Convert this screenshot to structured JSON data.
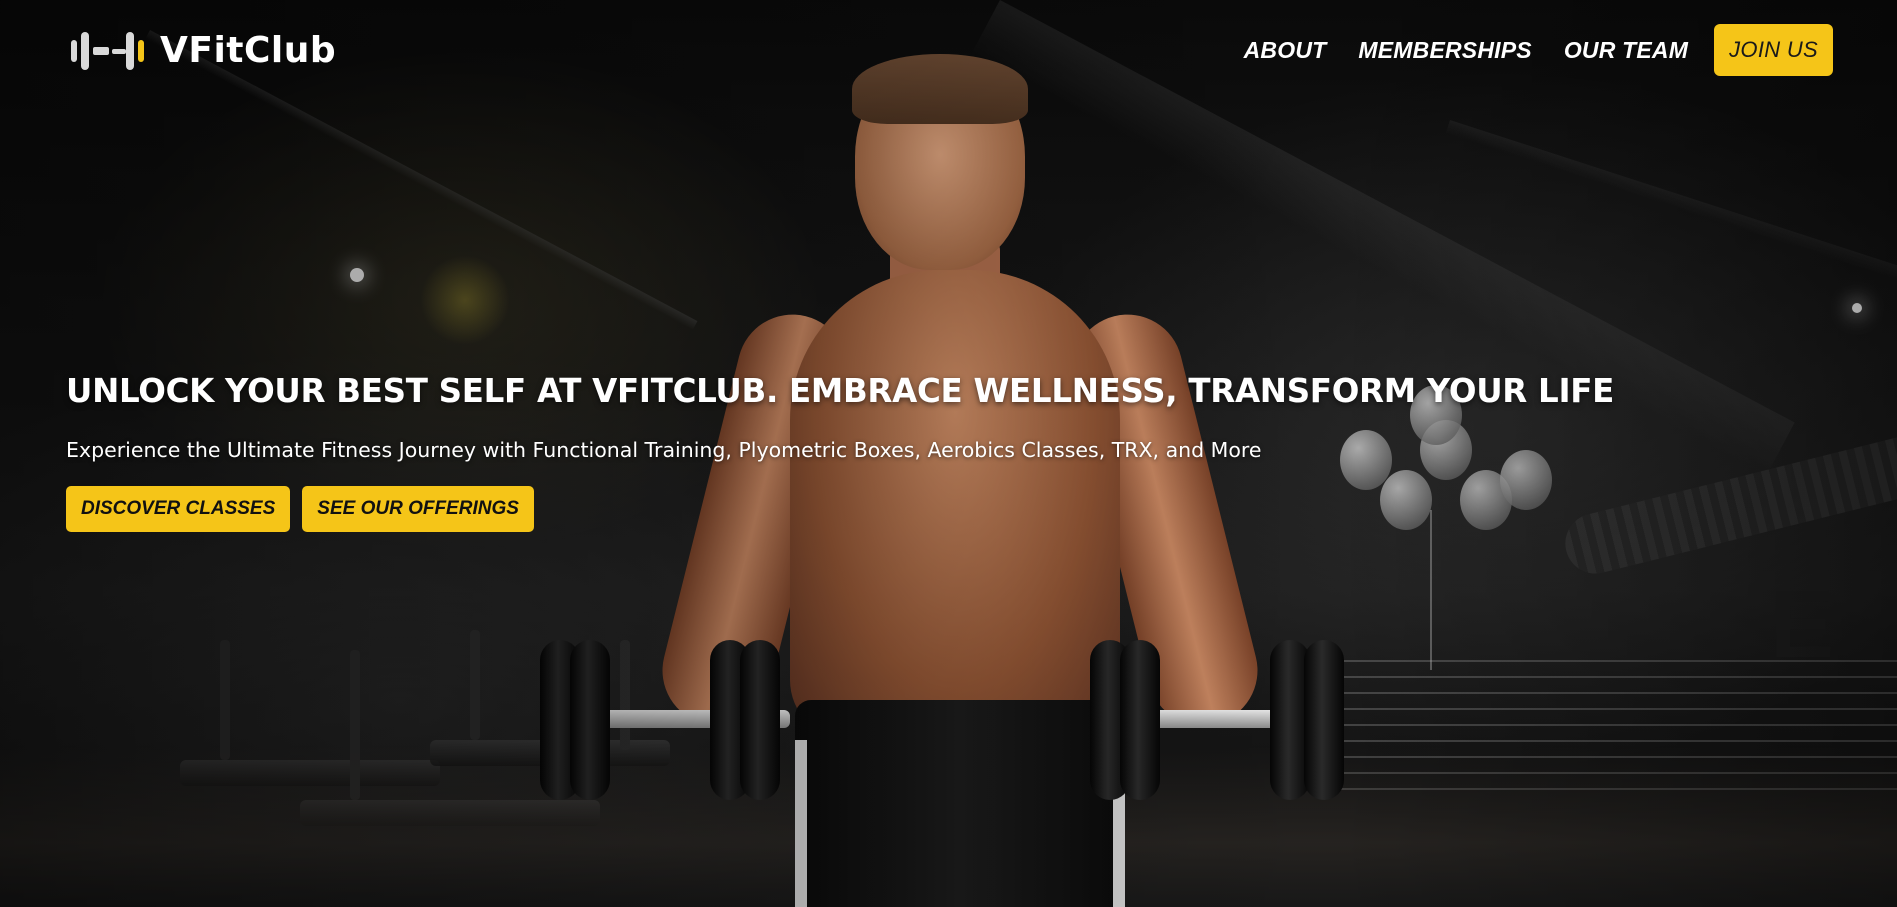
{
  "brand": {
    "name": "VFitClub",
    "logo_icon": "dumbbell-logo-icon"
  },
  "nav": {
    "items": [
      {
        "label": "ABOUT"
      },
      {
        "label": "MEMBERSHIPS"
      },
      {
        "label": "OUR TEAM"
      }
    ],
    "join_label": "JOIN US"
  },
  "hero": {
    "title": "UNLOCK YOUR BEST SELF AT VFITCLUB. EMBRACE WELLNESS, TRANSFORM YOUR LIFE",
    "subtitle": "Experience the Ultimate Fitness Journey with Functional Training, Plyometric Boxes, Aerobics Classes, TRX, and More",
    "cta_primary": "DISCOVER CLASSES",
    "cta_secondary": "SEE OUR OFFERINGS",
    "background_image": "man-holding-dumbbells-in-gym-photo"
  },
  "colors": {
    "accent": "#f5c518",
    "text_on_accent": "#111111",
    "text": "#ffffff"
  }
}
